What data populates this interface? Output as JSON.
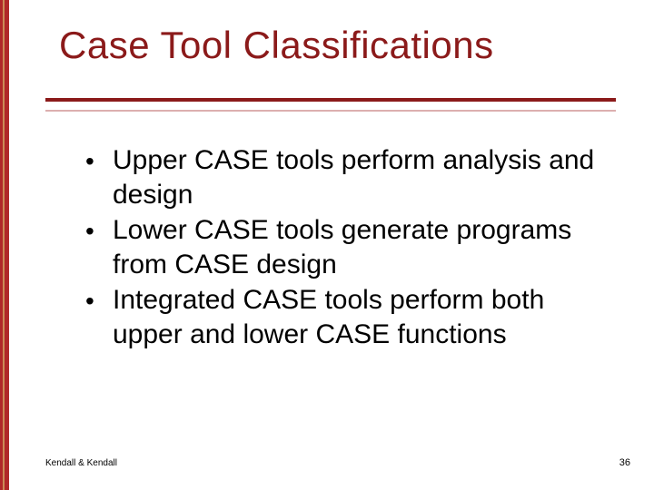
{
  "title": "Case Tool Classifications",
  "bullets": [
    "Upper CASE tools perform analysis and design",
    "Lower CASE tools generate programs from CASE design",
    "Integrated CASE tools perform both upper and lower CASE functions"
  ],
  "footer": {
    "left": "Kendall & Kendall",
    "right": "36"
  }
}
